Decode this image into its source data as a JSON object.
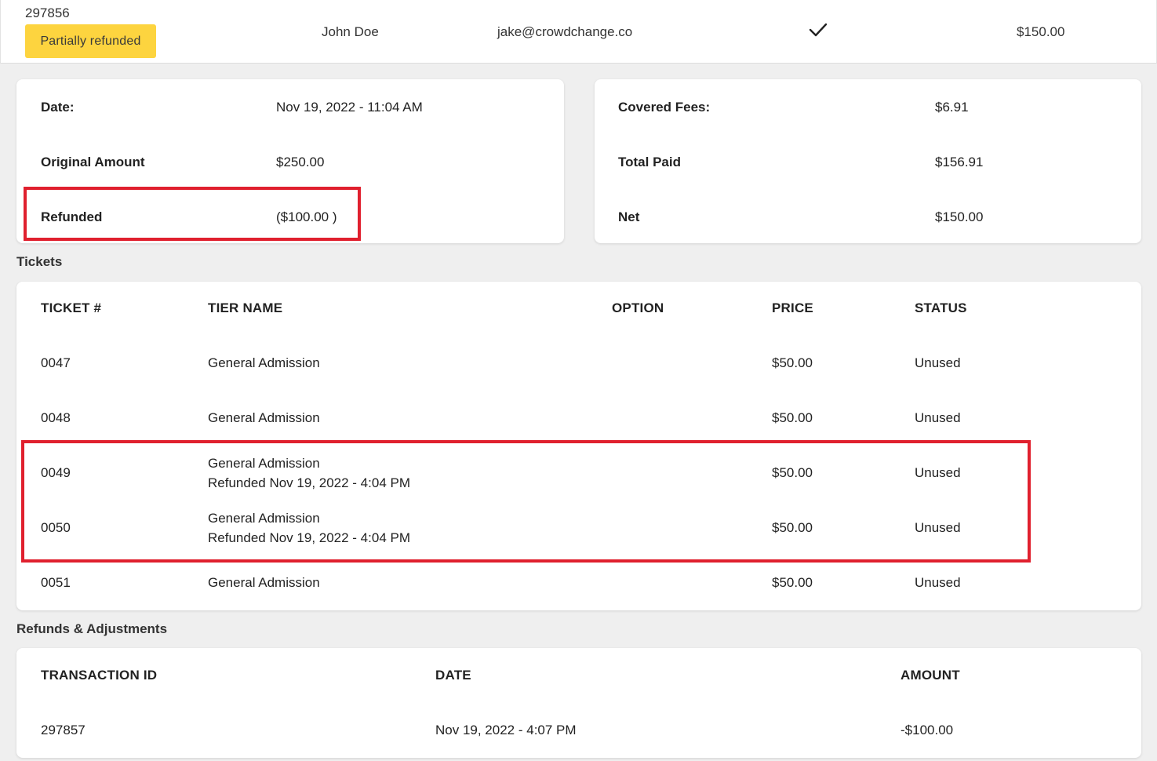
{
  "header": {
    "order_id": "297856",
    "status": "Partially refunded",
    "name": "John Doe",
    "email": "jake@crowdchange.co",
    "total": "$150.00",
    "check_icon": "check-icon",
    "status_color": "#fdd43f"
  },
  "summary_left": {
    "date_label": "Date:",
    "date_value": "Nov 19, 2022 - 11:04 AM",
    "original_label": "Original Amount",
    "original_value": "$250.00",
    "refunded_label": "Refunded",
    "refunded_value": "($100.00 )"
  },
  "summary_right": {
    "fees_label": "Covered Fees:",
    "fees_value": "$6.91",
    "paid_label": "Total Paid",
    "paid_value": "$156.91",
    "net_label": "Net",
    "net_value": "$150.00"
  },
  "tickets": {
    "title": "Tickets",
    "columns": [
      "TICKET #",
      "TIER NAME",
      "OPTION",
      "PRICE",
      "STATUS"
    ],
    "rows": [
      {
        "ticket": "0047",
        "tier": "General Admission",
        "note": "",
        "option": "",
        "price": "$50.00",
        "status": "Unused"
      },
      {
        "ticket": "0048",
        "tier": "General Admission",
        "note": "",
        "option": "",
        "price": "$50.00",
        "status": "Unused"
      },
      {
        "ticket": "0049",
        "tier": "General Admission",
        "note": "Refunded Nov 19, 2022 - 4:04 PM",
        "option": "",
        "price": "$50.00",
        "status": "Unused"
      },
      {
        "ticket": "0050",
        "tier": "General Admission",
        "note": "Refunded Nov 19, 2022 - 4:04 PM",
        "option": "",
        "price": "$50.00",
        "status": "Unused"
      },
      {
        "ticket": "0051",
        "tier": "General Admission",
        "note": "",
        "option": "",
        "price": "$50.00",
        "status": "Unused"
      }
    ]
  },
  "refunds": {
    "title": "Refunds & Adjustments",
    "columns": [
      "TRANSACTION ID",
      "DATE",
      "AMOUNT"
    ],
    "rows": [
      {
        "transaction_id": "297857",
        "date": "Nov 19, 2022 - 4:07 PM",
        "amount": "-$100.00"
      }
    ]
  },
  "highlight_color": "#e0202e"
}
